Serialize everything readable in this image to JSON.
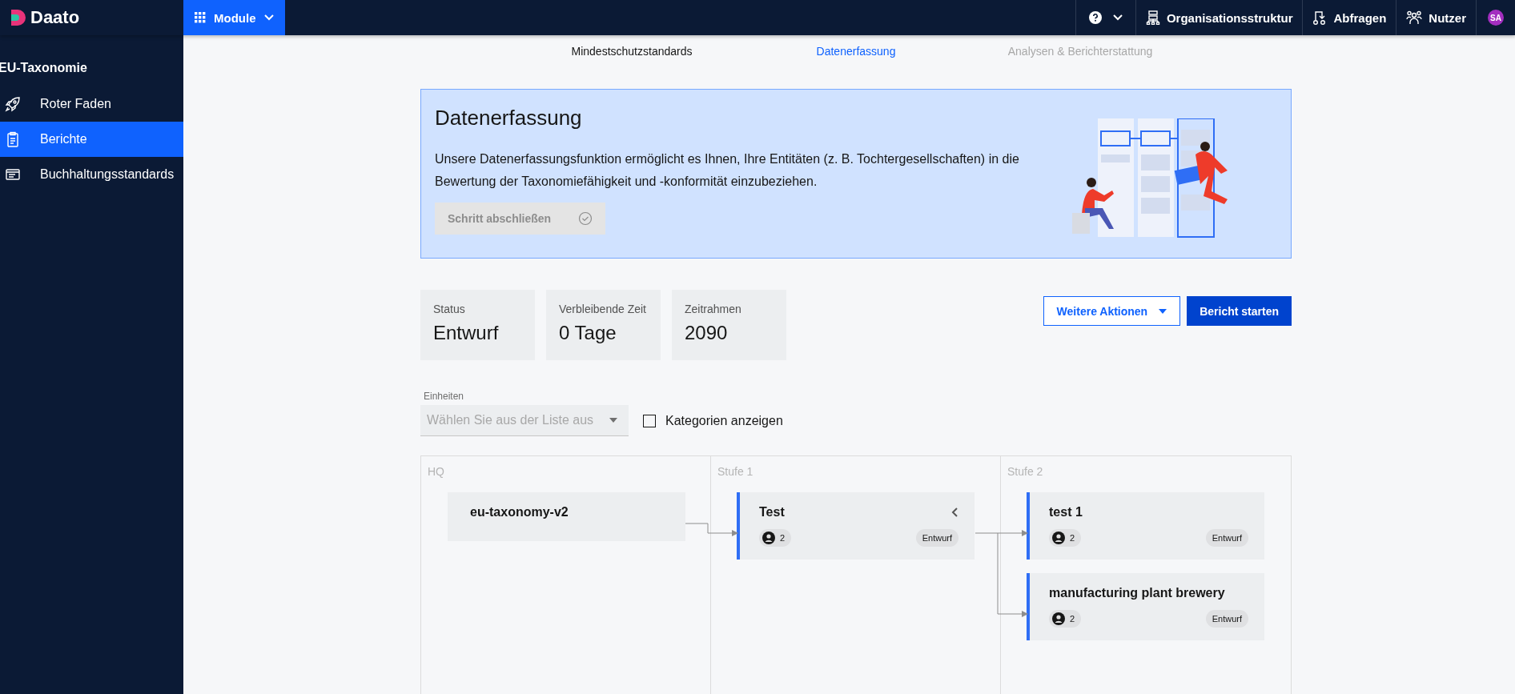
{
  "topbar": {
    "logo": "Daato",
    "module_button": "Module",
    "nav": [
      {
        "label": "Organisationsstruktur"
      },
      {
        "label": "Abfragen"
      },
      {
        "label": "Nutzer"
      }
    ],
    "avatar": "SA"
  },
  "sidebar": {
    "title": "EU-Taxonomie",
    "items": [
      {
        "label": "Roter Faden",
        "selected": false
      },
      {
        "label": "Berichte",
        "selected": true
      },
      {
        "label": "Buchhaltungsstandards",
        "selected": false
      }
    ]
  },
  "tabs": [
    {
      "label": "Mindestschutzstandards",
      "selected": false,
      "disabled": false
    },
    {
      "label": "Datenerfassung",
      "selected": true,
      "disabled": false
    },
    {
      "label": "Analysen & Berichterstattung",
      "selected": false,
      "disabled": true
    }
  ],
  "banner": {
    "title": "Datenerfassung",
    "text": "Unsere Datenerfassungsfunktion ermöglicht es Ihnen, Ihre Entitäten (z. B. Tochtergesellschaften) in die Bewertung der Taxonomiefähigkeit und -konformität einzubeziehen.",
    "button": {
      "label": "Schritt abschließen",
      "disabled": true
    }
  },
  "stats": [
    {
      "label": "Status",
      "value": "Entwurf"
    },
    {
      "label": "Verbleibende Zeit",
      "value": "0 Tage"
    },
    {
      "label": "Zeitrahmen",
      "value": "2090"
    }
  ],
  "actions": {
    "more": "Weitere Aktionen",
    "primary": "Bericht starten"
  },
  "filter": {
    "label": "Einheiten",
    "placeholder": "Wählen Sie aus der Liste aus",
    "checkbox": {
      "label": "Kategorien anzeigen",
      "checked": false
    }
  },
  "tree": {
    "columns": [
      {
        "title": "HQ",
        "nodes": [
          {
            "kind": "root",
            "name": "eu-taxonomy-v2"
          }
        ]
      },
      {
        "title": "Stufe 1",
        "nodes": [
          {
            "kind": "entity",
            "name": "Test",
            "users": "2",
            "status": "Entwurf",
            "expanded": true
          }
        ]
      },
      {
        "title": "Stufe 2",
        "nodes": [
          {
            "kind": "entity",
            "name": "test 1",
            "users": "2",
            "status": "Entwurf"
          },
          {
            "kind": "entity",
            "name": "manufacturing plant brewery",
            "users": "2",
            "status": "Entwurf"
          }
        ]
      }
    ]
  }
}
